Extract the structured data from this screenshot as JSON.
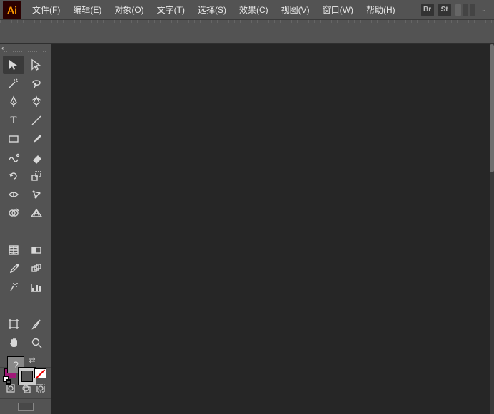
{
  "app": {
    "logo_text": "Ai"
  },
  "menubar": {
    "items": [
      "文件(F)",
      "编辑(E)",
      "对象(O)",
      "文字(T)",
      "选择(S)",
      "效果(C)",
      "视图(V)",
      "窗口(W)",
      "帮助(H)"
    ],
    "right_badges": [
      "Br",
      "St"
    ]
  },
  "tools": {
    "left_col": [
      "selection",
      "magic-wand",
      "pen",
      "type",
      "rectangle",
      "paintbrush",
      "rotate",
      "width",
      "shape-builder",
      "mesh",
      "eyedropper",
      "symbol-sprayer",
      "artboard",
      "hand"
    ],
    "right_col": [
      "direct-selection",
      "lasso",
      "curvature",
      "line-segment",
      "pencil",
      "eraser",
      "scale",
      "puppet-warp",
      "free-transform",
      "gradient",
      "blend",
      "column-graph",
      "slice",
      "zoom"
    ]
  },
  "fill_stroke": {
    "fill_unknown_glyph": "?",
    "swap_glyph": "⇄"
  }
}
